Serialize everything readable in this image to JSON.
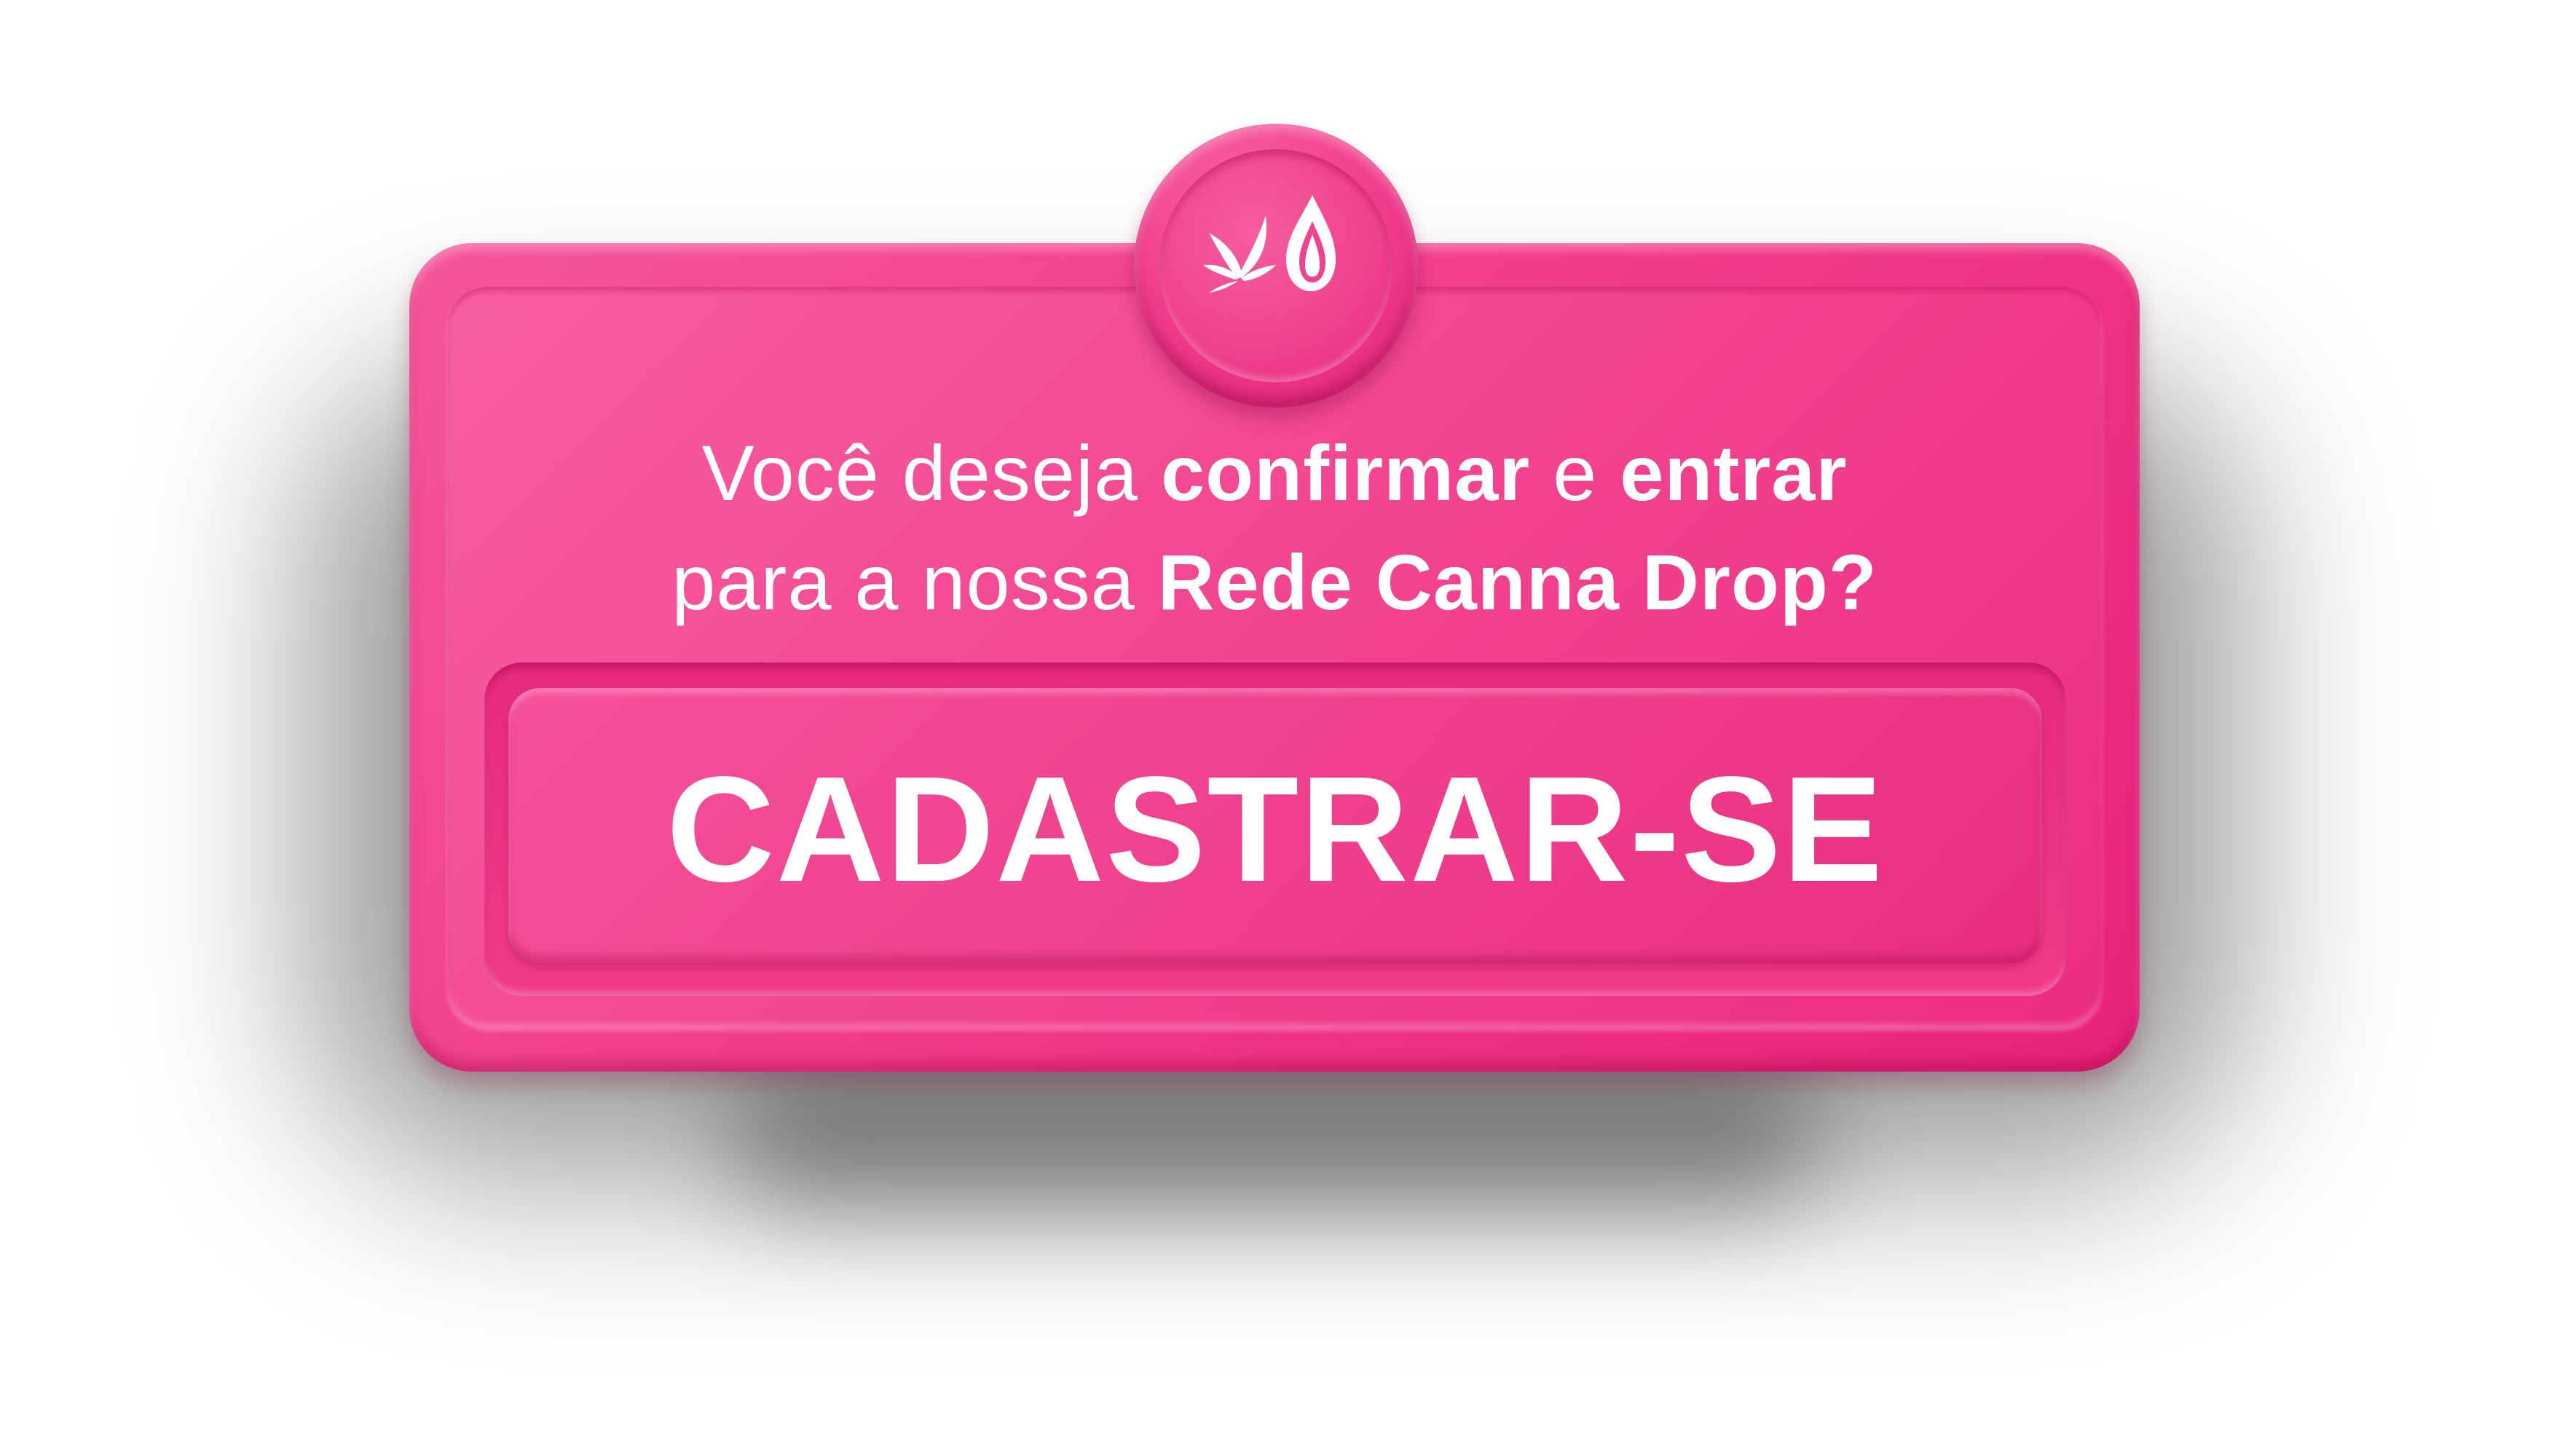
{
  "dialog": {
    "question_line1": {
      "part1": "Você deseja ",
      "part2": "confirmar",
      "part3": " e ",
      "part4": "entrar"
    },
    "question_line2": {
      "part1": "para a nossa ",
      "part2": "Rede Canna Drop?"
    },
    "cta_label": "CADASTRAR-SE"
  },
  "icons": {
    "logo": "canna-drop-logo-icon"
  },
  "colors": {
    "accent": "#f2408d",
    "text": "#ffffff"
  }
}
